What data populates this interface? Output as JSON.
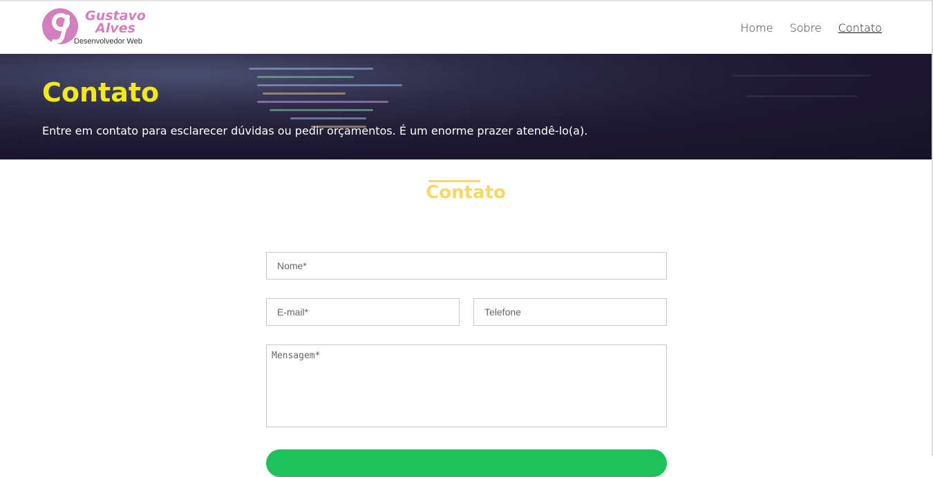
{
  "brand": {
    "name_line1": "Gustavo",
    "name_line2": "Alves",
    "tagline": "Desenvolvedor Web",
    "logo_letter": "g",
    "color": "#d47fbd"
  },
  "nav": {
    "items": [
      {
        "label": "Home",
        "active": false
      },
      {
        "label": "Sobre",
        "active": false
      },
      {
        "label": "Contato",
        "active": true
      }
    ]
  },
  "hero": {
    "title": "Contato",
    "subtitle": "Entre em contato para esclarecer dúvidas ou pedir orçamentos. É um enorme prazer atendê-lo(a).",
    "title_color": "#f5e915"
  },
  "section": {
    "title": "Contato",
    "accent_color": "#f6d866"
  },
  "form": {
    "name_placeholder": "Nome*",
    "email_placeholder": "E-mail*",
    "phone_placeholder": "Telefone",
    "message_placeholder": "Mensagem*",
    "submit_color": "#1fc15a"
  }
}
